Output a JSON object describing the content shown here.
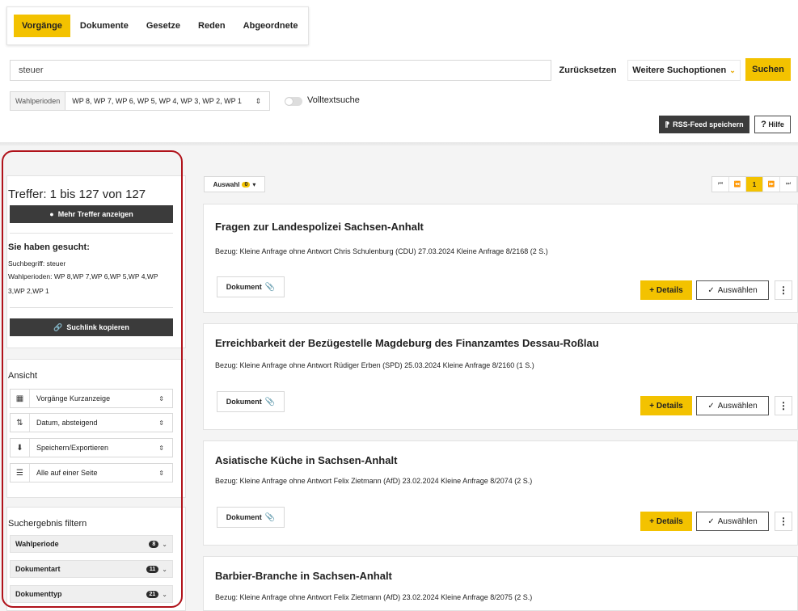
{
  "tabs": [
    {
      "label": "Vorgänge",
      "active": true
    },
    {
      "label": "Dokumente"
    },
    {
      "label": "Gesetze"
    },
    {
      "label": "Reden"
    },
    {
      "label": "Abgeordnete"
    }
  ],
  "search": {
    "value": "steuer",
    "reset_label": "Zurücksetzen",
    "more_options_label": "Weitere Suchoptionen",
    "search_label": "Suchen"
  },
  "periods": {
    "label": "Wahlperioden",
    "value": "WP 8, WP 7, WP 6, WP 5, WP 4, WP 3, WP 2, WP 1",
    "fulltext_label": "Volltextsuche"
  },
  "toolbar": {
    "rss_label": "RSS-Feed speichern",
    "help_label": "Hilfe"
  },
  "sidebar": {
    "hits_title": "Treffer: 1 bis 127 von 127",
    "more_hits_label": "Mehr Treffer anzeigen",
    "searched_title": "Sie haben gesucht:",
    "term_line": "Suchbegriff: steuer",
    "period_line_1": "Wahlperioden: WP 8,WP 7,WP 6,WP 5,WP 4,WP",
    "period_line_2": "3,WP 2,WP 1",
    "copy_link_label": "Suchlink kopieren",
    "view_title": "Ansicht",
    "view_options": [
      {
        "label": "Vorgänge Kurzanzeige",
        "icon": "table-icon"
      },
      {
        "label": "Datum, absteigend",
        "icon": "sort-icon"
      },
      {
        "label": "Speichern/Exportieren",
        "icon": "download-icon"
      },
      {
        "label": "Alle auf einer Seite",
        "icon": "list-icon"
      }
    ],
    "filter_title": "Suchergebnis filtern",
    "filters": [
      {
        "label": "Wahlperiode",
        "count": "8"
      },
      {
        "label": "Dokumentart",
        "count": "11"
      },
      {
        "label": "Dokumenttyp",
        "count": "21"
      }
    ]
  },
  "results_toolbar": {
    "auswahl_label": "Auswahl",
    "auswahl_count": "0",
    "pager_current": "1"
  },
  "result_labels": {
    "document": "Dokument",
    "details": "+ Details",
    "select": "Auswählen",
    "kebab": "⋮"
  },
  "results": [
    {
      "title": "Fragen zur Landespolizei Sachsen-Anhalt",
      "ref": "Bezug: Kleine Anfrage ohne Antwort Chris Schulenburg (CDU) 27.03.2024 Kleine Anfrage 8/2168 (2 S.)"
    },
    {
      "title": "Erreichbarkeit der Bezügestelle Magdeburg des Finanzamtes Dessau-Roßlau",
      "ref": "Bezug: Kleine Anfrage ohne Antwort Rüdiger Erben (SPD) 25.03.2024 Kleine Anfrage 8/2160 (1 S.)"
    },
    {
      "title": "Asiatische Küche in Sachsen-Anhalt",
      "ref": "Bezug: Kleine Anfrage ohne Antwort Felix Zietmann (AfD) 23.02.2024 Kleine Anfrage 8/2074 (2 S.)"
    },
    {
      "title": "Barbier-Branche in Sachsen-Anhalt",
      "ref": "Bezug: Kleine Anfrage ohne Antwort Felix Zietmann (AfD) 23.02.2024 Kleine Anfrage 8/2075 (2 S.)"
    }
  ],
  "colors": {
    "accent": "#f3c200",
    "dark": "#3b3b3b",
    "highlight": "#b0121a"
  }
}
